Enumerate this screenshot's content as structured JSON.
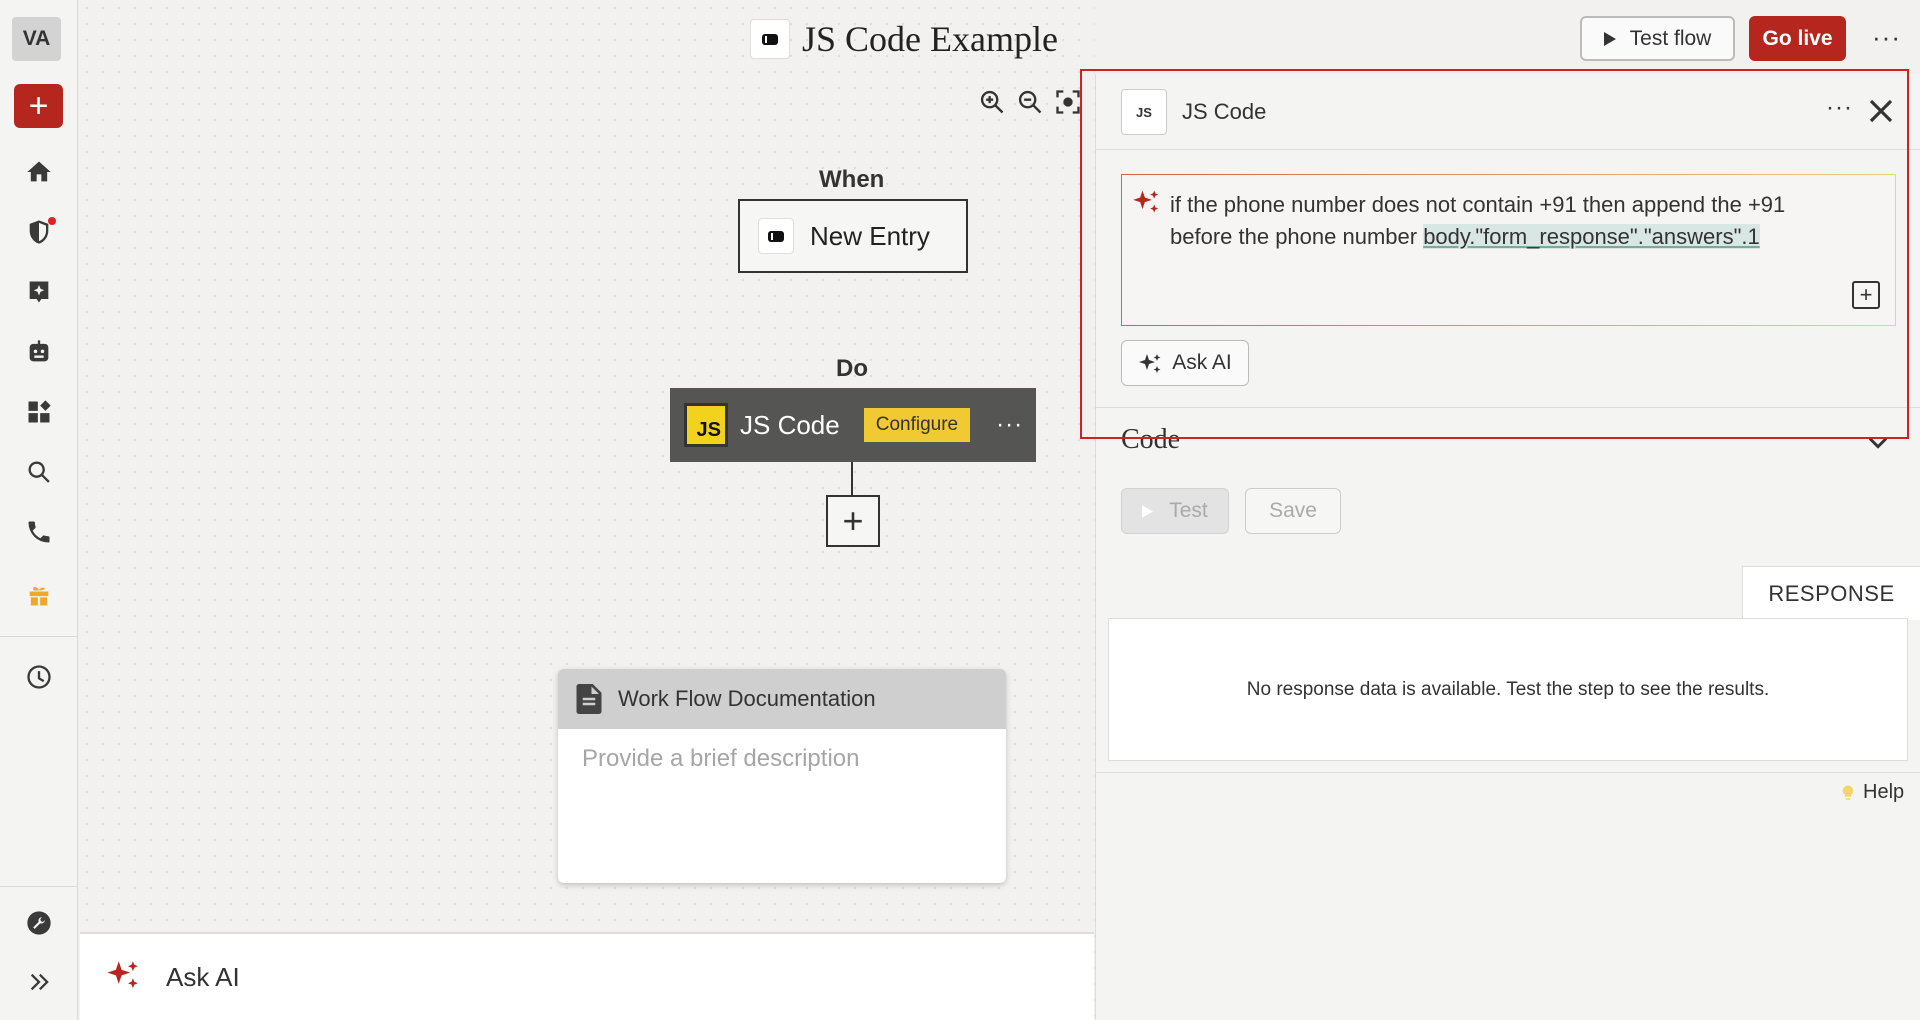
{
  "sidebar": {
    "avatar_initials": "VA",
    "new_symbol": "+",
    "items": [
      {
        "name": "home-icon"
      },
      {
        "name": "shield-icon",
        "has_notification_dot": true
      },
      {
        "name": "ai-agent-icon"
      },
      {
        "name": "robot-icon"
      },
      {
        "name": "apps-icon"
      },
      {
        "name": "search-icon"
      },
      {
        "name": "phone-icon"
      },
      {
        "name": "gift-icon"
      },
      {
        "name": "history-icon"
      },
      {
        "name": "tools-icon"
      },
      {
        "name": "expand-sidebar-icon"
      }
    ]
  },
  "header": {
    "flow_title": "JS Code Example",
    "test_flow_label": "Test flow",
    "go_live_label": "Go live",
    "more_label": "···"
  },
  "canvas": {
    "when_label": "When",
    "trigger_label": "New Entry",
    "do_label": "Do",
    "action_badge": "JS",
    "action_label": "JS Code",
    "configure_label": "Configure",
    "action_more": "···",
    "add_step_symbol": "+",
    "doc_card": {
      "title": "Work Flow Documentation",
      "placeholder": "Provide a brief description"
    },
    "ask_ai_label": "Ask AI"
  },
  "panel": {
    "icon_text": "JS",
    "title": "JS Code",
    "more_label": "···",
    "prompt_text": "if the phone number does not contain +91 then append the +91 before the phone number ",
    "prompt_token": "body.\"form_response\".\"answers\".1",
    "expand_symbol": "+",
    "ask_ai_label": "Ask AI",
    "code_section_label": "Code",
    "test_label": "Test",
    "save_label": "Save",
    "response_tab": "RESPONSE",
    "response_empty": "No response data is available. Test the step to see the results.",
    "help_label": "Help"
  },
  "colors": {
    "brand_red": "#b5261e",
    "configure_yellow": "#f0c933",
    "js_yellow": "#f1d21d",
    "highlight_red": "#d42020"
  }
}
